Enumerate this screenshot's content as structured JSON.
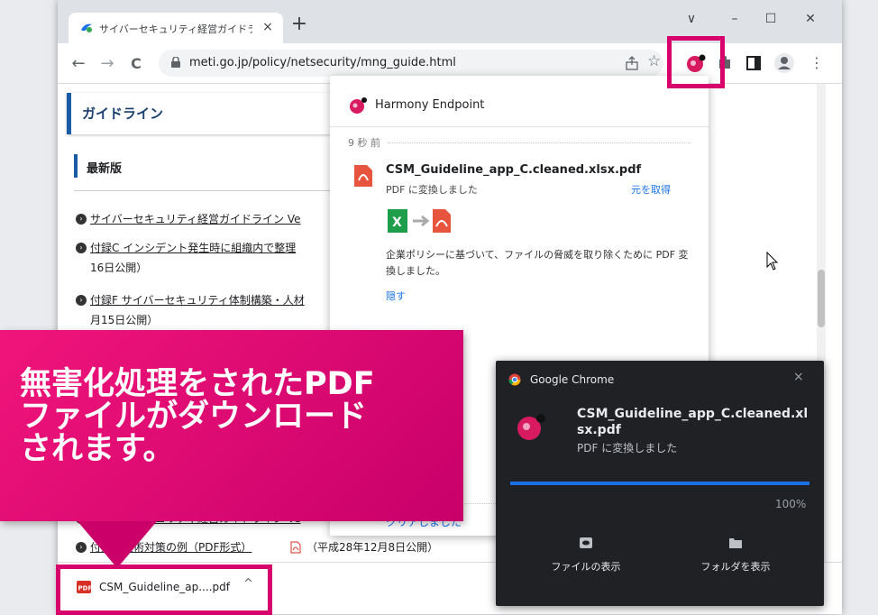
{
  "browser": {
    "tab_title": "サイバーセキュリティ経営ガイドラインと",
    "tab_close": "×",
    "new_tab": "+",
    "win_min": "–",
    "win_max": "☐",
    "win_close": "✕",
    "win_dropdown": "∨",
    "nav_back": "←",
    "nav_forward": "→",
    "nav_reload": "C",
    "url": "meti.go.jp/policy/netsecurity/mng_guide.html",
    "star": "☆",
    "menu": "⋮"
  },
  "page": {
    "guide_heading": "ガイドライン",
    "section_heading": "最新版",
    "items": [
      {
        "text": "サイバーセキュリティ経営ガイドライン Ve",
        "sub": ""
      },
      {
        "text": "付録C インシデント発生時に組織内で整理",
        "sub": "16日公開）"
      },
      {
        "text": "付録F サイバーセキュリティ体制構築・人材",
        "sub": "月15日公開）"
      },
      {
        "text": "サイバーセキュリティ経営ガイドライン Ve",
        "sub": ""
      },
      {
        "text": "付録　技術対策の例（PDF形式）",
        "sub": "（平成28年12月8日公開）"
      }
    ]
  },
  "panel": {
    "title": "Harmony Endpoint",
    "time_ago": "9 秒 前",
    "file_name": "CSM_Guideline_app_C.cleaned.xlsx.pdf",
    "file_status": "PDF に変換しました",
    "restore_link": "元を取得",
    "description": "企業ポリシーに基づいて、ファイルの脅威を取り除くために PDF 変換しました。",
    "hide_link": "隠す",
    "cleared_text": "クリアしました"
  },
  "notification": {
    "app_name": "Google Chrome",
    "close": "×",
    "title": "CSM_Guideline_app_C.cleaned.xlsx.pdf",
    "body": "PDF に変換しました",
    "progress_percent": 100,
    "progress_label": "100%",
    "show_file_button": "ファイルの表示",
    "show_folder_button": "フォルダを表示"
  },
  "download_bar": {
    "file_label": "CSM_Guideline_ap....pdf",
    "caret": "^"
  },
  "callout": {
    "text": "無害化処理をされたPDF\nファイルがダウンロード\nされます。"
  },
  "colors": {
    "accent_magenta": "#d8006c",
    "chrome_blue": "#1a73e8",
    "heading_blue": "#1a5ba6"
  }
}
